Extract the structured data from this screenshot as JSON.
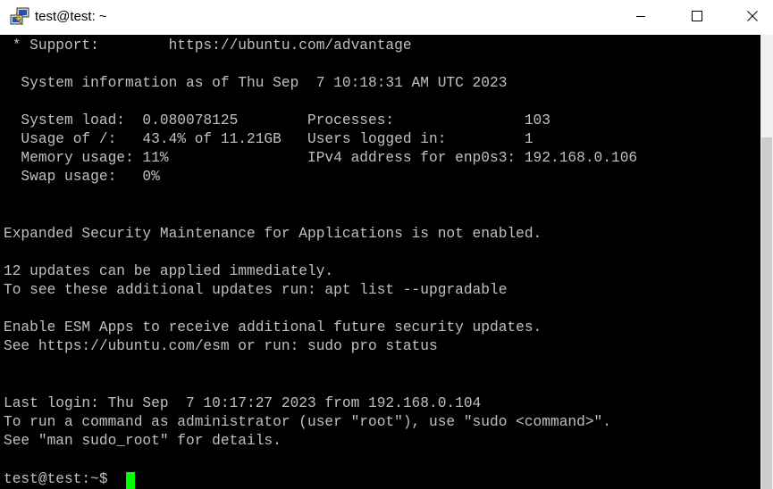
{
  "window": {
    "title": "test@test: ~",
    "icons": {
      "app": "putty-icon",
      "minimize": "minimize-icon",
      "maximize": "maximize-icon",
      "close": "close-icon"
    }
  },
  "terminal": {
    "lines": [
      " * Support:        https://ubuntu.com/advantage",
      "",
      "  System information as of Thu Sep  7 10:18:31 AM UTC 2023",
      "",
      "  System load:  0.080078125        Processes:               103",
      "  Usage of /:   43.4% of 11.21GB   Users logged in:         1",
      "  Memory usage: 11%                IPv4 address for enp0s3: 192.168.0.106",
      "  Swap usage:   0%",
      "",
      "",
      "Expanded Security Maintenance for Applications is not enabled.",
      "",
      "12 updates can be applied immediately.",
      "To see these additional updates run: apt list --upgradable",
      "",
      "Enable ESM Apps to receive additional future security updates.",
      "See https://ubuntu.com/esm or run: sudo pro status",
      "",
      "",
      "Last login: Thu Sep  7 10:17:27 2023 from 192.168.0.104",
      "To run a command as administrator (user \"root\"), use \"sudo <command>\".",
      "See \"man sudo_root\" for details.",
      "",
      "test@test:~$ "
    ],
    "colors": {
      "background": "#000000",
      "foreground": "#c0c0c0",
      "cursor": "#00ff00"
    }
  }
}
